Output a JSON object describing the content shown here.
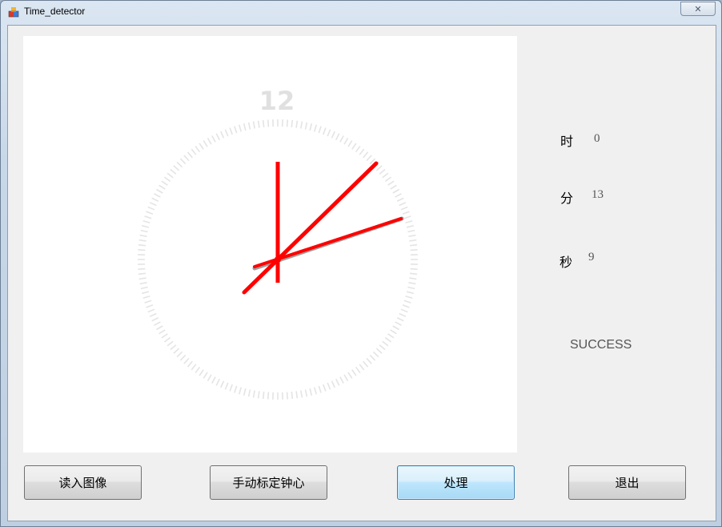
{
  "window": {
    "title": "Time_detector",
    "close_symbol": "✕"
  },
  "clock_image": {
    "numeral": "12",
    "colors": {
      "hands": "#ff0000",
      "ticks": "#e4e4e4",
      "numeral": "#e0e0e0"
    }
  },
  "results": {
    "hour_label": "时",
    "hour_value": "0",
    "minute_label": "分",
    "minute_value": "13",
    "second_label": "秒",
    "second_value": "9",
    "status": "SUCCESS"
  },
  "buttons": {
    "load_image": "读入图像",
    "calibrate_center": "手动标定钟心",
    "process": "处理",
    "exit": "退出"
  }
}
